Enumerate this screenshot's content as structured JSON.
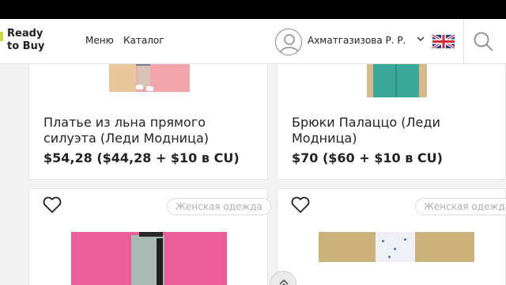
{
  "header": {
    "logo_text": "Ready\nto Buy",
    "nav": [
      "Меню",
      "Каталог"
    ],
    "user_name": "Ахматгазизова Р. Р."
  },
  "products": [
    {
      "title": "Платье из льна прямого силуэта (Леди Модница)",
      "price": "$54,28 ($44,28 + $10 в CU)"
    },
    {
      "title": "Брюки Палаццо (Леди Модница)",
      "price": "$70 ($60 + $10 в CU)"
    },
    {
      "tag": "Женская одежда"
    },
    {
      "tag": "Женская одежда"
    }
  ],
  "colors": {
    "accent": "#c8d84a",
    "text": "#222222",
    "tag_text": "#b0b0b0"
  }
}
